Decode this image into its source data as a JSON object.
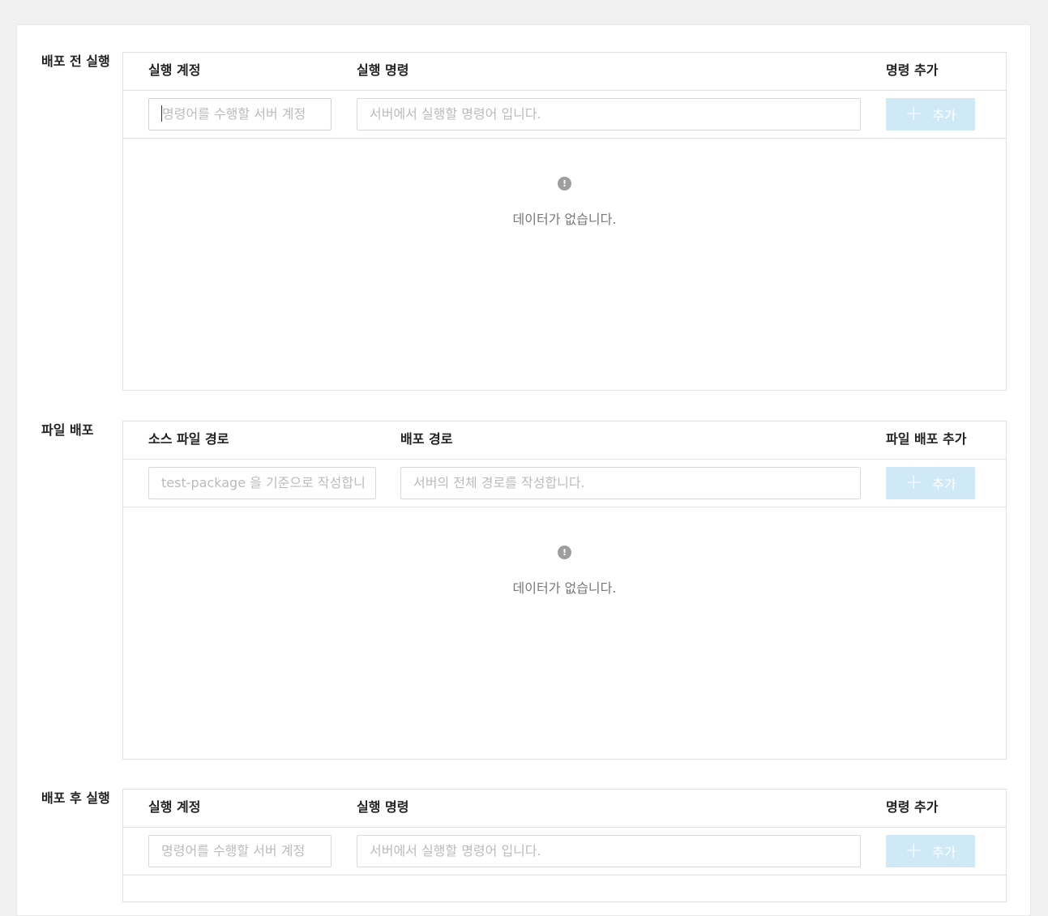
{
  "sections": [
    {
      "label": "배포 전 실행",
      "headers": [
        "실행 계정",
        "실행 명령",
        "명령 추가"
      ],
      "input1_placeholder": "명령어를 수행할 서버 계정을 입력합니다.",
      "input1_visible": "명령어를 수행할 서버 계정",
      "input2_placeholder": "서버에서 실행할 명령어 입니다.",
      "add_label": "추가",
      "empty_text": "데이터가 없습니다."
    },
    {
      "label": "파일 배포",
      "headers": [
        "소스 파일 경로",
        "배포 경로",
        "파일 배포 추가"
      ],
      "input1_placeholder": "test-package 을 기준으로 작성합니다.",
      "input1_visible": "test-package 을 기준으로 작성합니",
      "input2_placeholder": "서버의 전체 경로를 작성합니다.",
      "add_label": "추가",
      "empty_text": "데이터가 없습니다."
    },
    {
      "label": "배포 후 실행",
      "headers": [
        "실행 계정",
        "실행 명령",
        "명령 추가"
      ],
      "input1_placeholder": "명령어를 수행할 서버 계정을 입력합니다.",
      "input1_visible": "명령어를 수행할 서버 계정",
      "input2_placeholder": "서버에서 실행할 명령어 입니다.",
      "add_label": "추가"
    }
  ],
  "icons": {
    "add": "plus-icon",
    "empty": "exclamation-circle-icon"
  },
  "colors": {
    "add_button_bg": "#cfe9f7",
    "placeholder": "#bbbbbb",
    "empty_icon": "#9e9e9e"
  }
}
